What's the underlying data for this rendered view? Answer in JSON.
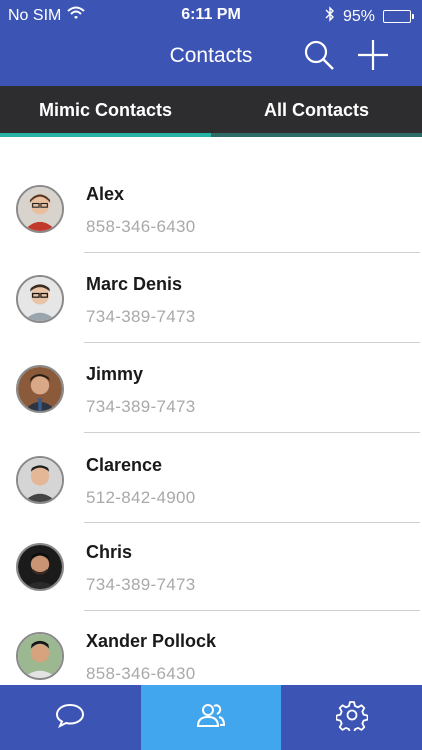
{
  "status_bar": {
    "carrier": "No SIM",
    "time": "6:11 PM",
    "battery_percent": "95%",
    "battery_level": 0.95
  },
  "nav": {
    "title": "Contacts",
    "search_icon": "search-icon",
    "add_icon": "plus-icon"
  },
  "tabs": [
    {
      "label": "Mimic Contacts",
      "active": true
    },
    {
      "label": "All Contacts",
      "active": false
    }
  ],
  "contacts": [
    {
      "name": "Alex",
      "phone": "858-346-6430"
    },
    {
      "name": "Marc Denis",
      "phone": "734-389-7473"
    },
    {
      "name": "Jimmy",
      "phone": "734-389-7473"
    },
    {
      "name": "Clarence",
      "phone": "512-842-4900"
    },
    {
      "name": "Chris",
      "phone": "734-389-7473"
    },
    {
      "name": "Xander Pollock",
      "phone": "858-346-6430"
    }
  ],
  "bottom_nav": [
    {
      "icon": "chat-bubble-icon",
      "active": false
    },
    {
      "icon": "contacts-icon",
      "active": true
    },
    {
      "icon": "gear-icon",
      "active": false
    }
  ],
  "colors": {
    "header": "#3c54b4",
    "tab_bar": "#2d2d2f",
    "tab_indicator": "#24b3a4",
    "bottom_active": "#42a6ee"
  }
}
